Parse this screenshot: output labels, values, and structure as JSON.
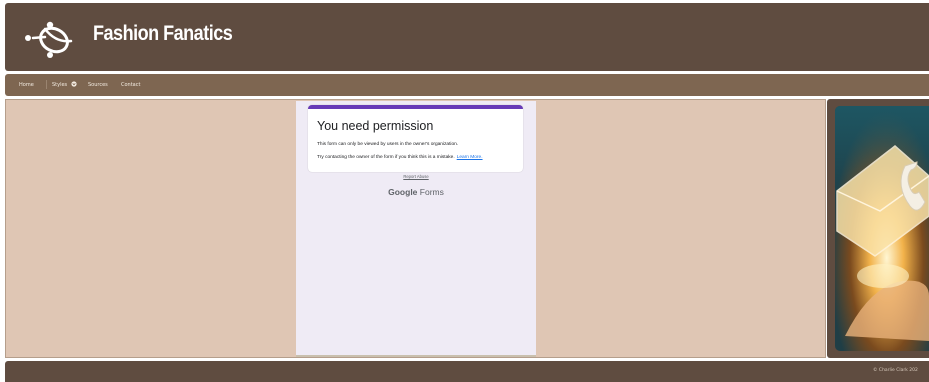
{
  "site": {
    "title": "Fashion Fanatics",
    "logo_icon": "swirl-logo-icon"
  },
  "nav": {
    "items": [
      {
        "label": "Home"
      },
      {
        "label": "Styles"
      },
      {
        "label": "Sources"
      },
      {
        "label": "Contact"
      }
    ],
    "styles_dropdown_icon": "chevron-down-icon"
  },
  "form": {
    "title": "You need permission",
    "line1": "This form can only be viewed by users in the owner's organization.",
    "line2": "Try contacting the owner of the form if you think this is a mistake.",
    "learn_more": "Learn More.",
    "report_abuse": "Report Abuse",
    "brand": "Google",
    "product": "Forms"
  },
  "sidebar": {
    "image_icon": "envelope-phone-hand-image"
  },
  "footer": {
    "copyright": "© Charlie Clark 202"
  },
  "colors": {
    "header_bg": "#5f4c40",
    "nav_bg": "#7e6651",
    "main_bg": "#dfc6b4",
    "form_bg": "#efebf5",
    "form_accent": "#673ab7",
    "link": "#1a73e8"
  }
}
